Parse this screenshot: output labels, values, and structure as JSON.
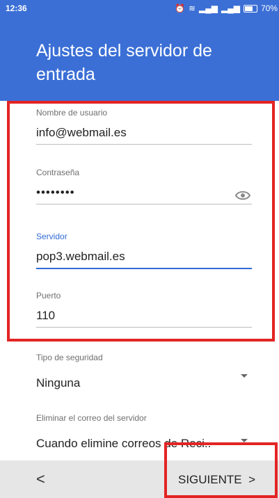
{
  "status": {
    "time": "12:36",
    "battery": "70%",
    "icons": [
      "alarm-icon",
      "wifi-icon",
      "signal-icon",
      "signal-icon",
      "battery-icon"
    ]
  },
  "header": {
    "title": "Ajustes del servidor de entrada"
  },
  "fields": {
    "username": {
      "label": "Nombre de usuario",
      "value": "info@webmail.es"
    },
    "password": {
      "label": "Contraseña",
      "value": "••••••••"
    },
    "server": {
      "label": "Servidor",
      "value": "pop3.webmail.es"
    },
    "port": {
      "label": "Puerto",
      "value": "110"
    }
  },
  "security": {
    "label": "Tipo de seguridad",
    "value": "Ninguna"
  },
  "delete": {
    "label": "Eliminar el correo del servidor",
    "value": "Cuando elimine correos de Reci.."
  },
  "footer": {
    "back": "<",
    "next": "SIGUIENTE"
  },
  "colors": {
    "primary": "#3b6fd6",
    "accent": "#2f6ad3",
    "highlight": "#e32424"
  }
}
